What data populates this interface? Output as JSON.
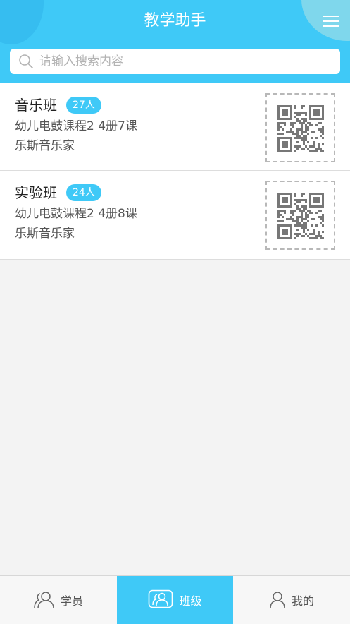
{
  "header": {
    "title": "教学助手"
  },
  "search": {
    "placeholder": "请输入搜索内容",
    "value": ""
  },
  "classes": [
    {
      "name": "音乐班",
      "count": "27人",
      "course": "幼儿电鼓课程2 4册7课",
      "org": "乐斯音乐家"
    },
    {
      "name": "实验班",
      "count": "24人",
      "course": "幼儿电鼓课程2 4册8课",
      "org": "乐斯音乐家"
    }
  ],
  "tabs": [
    {
      "label": "学员",
      "icon": "students-icon",
      "active": false
    },
    {
      "label": "班级",
      "icon": "class-icon",
      "active": true
    },
    {
      "label": "我的",
      "icon": "profile-icon",
      "active": false
    }
  ],
  "colors": {
    "accent": "#3fc9f7",
    "background": "#f3f3f3"
  }
}
